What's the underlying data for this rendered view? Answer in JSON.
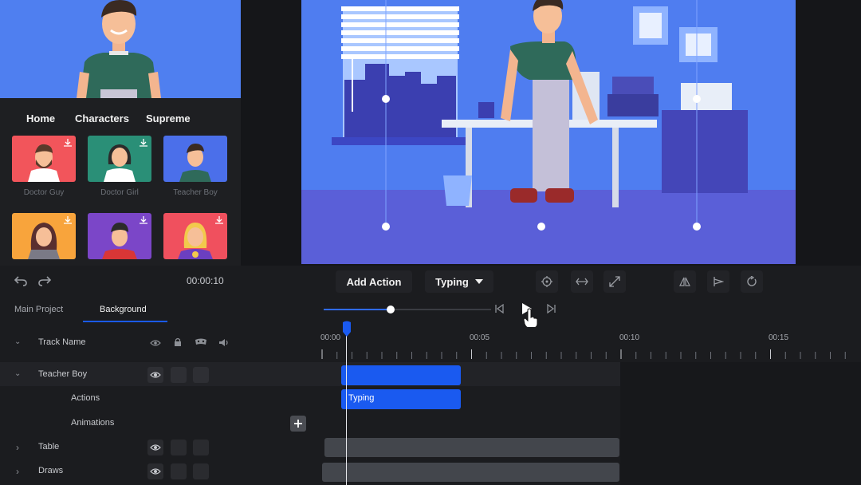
{
  "library": {
    "tabs": [
      "Home",
      "Characters",
      "Supreme"
    ],
    "characters": [
      {
        "name": "Doctor Guy",
        "bg": "#f2555b"
      },
      {
        "name": "Doctor Girl",
        "bg": "#2a8f77"
      },
      {
        "name": "Teacher Boy",
        "bg": "#4b6fea"
      },
      {
        "name": "",
        "bg": "#f8a43c"
      },
      {
        "name": "",
        "bg": "#7b46c8"
      },
      {
        "name": "",
        "bg": "#f0505e"
      }
    ]
  },
  "toolbar": {
    "time": "00:00:10",
    "add_action": "Add Action",
    "action_type": "Typing"
  },
  "tabs": {
    "main_project": "Main Project",
    "background": "Background"
  },
  "playback": {
    "progress": 0.4
  },
  "timeline": {
    "ruler_labels": [
      "00:00",
      "00:05",
      "00:10",
      "00:15"
    ],
    "header": "Track Name",
    "tracks": {
      "teacher_boy": "Teacher Boy",
      "actions": "Actions",
      "animations": "Animations",
      "table": "Table",
      "draws": "Draws"
    },
    "clip_typing": "Typing"
  },
  "colors": {
    "accent": "#1a5af0",
    "stage": "#4f7df0"
  }
}
